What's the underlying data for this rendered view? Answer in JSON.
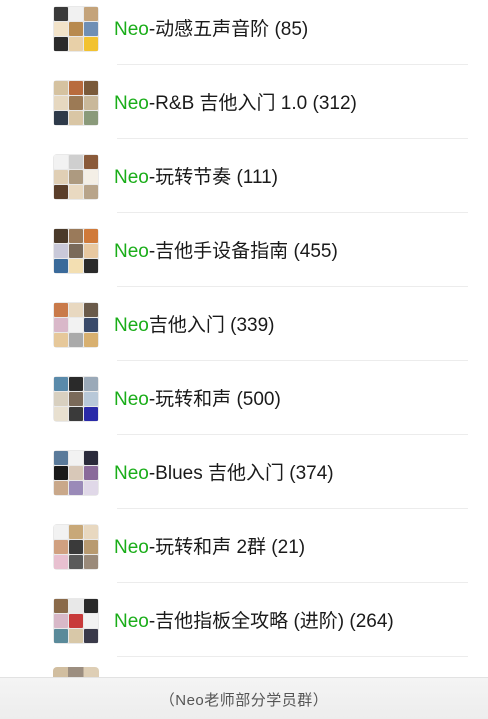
{
  "groups": [
    {
      "prefix": "Neo",
      "rest": "-动感五声音阶 (85)",
      "tiles": [
        "#3a3a3a",
        "#f1f1f1",
        "#c4a37a",
        "#f2e3c9",
        "#b88a4f",
        "#6f8fb5",
        "#2b2b2b",
        "#e8d0a8",
        "#f2c230"
      ]
    },
    {
      "prefix": "Neo",
      "rest": "-R&B 吉他入门 1.0 (312)",
      "tiles": [
        "#d5c2a0",
        "#b86b3d",
        "#7a5a3a",
        "#e6d8c0",
        "#9c7a55",
        "#c9b89a",
        "#2e3a4a",
        "#d9c6a5",
        "#8a9a7a"
      ]
    },
    {
      "prefix": "Neo",
      "rest": "-玩转节奏 (111)",
      "tiles": [
        "#f2f2f2",
        "#cfcfcf",
        "#8a5a3a",
        "#e0cfb5",
        "#ad9a80",
        "#f4efe6",
        "#5a3e2a",
        "#e9d9c1",
        "#b8a48a"
      ]
    },
    {
      "prefix": "Neo",
      "rest": "-吉他手设备指南 (455)",
      "tiles": [
        "#4a3a2a",
        "#9a7a5a",
        "#d07a3a",
        "#c9c9d9",
        "#7a6a5a",
        "#e8c8a0",
        "#3a6a9a",
        "#f3dfb2",
        "#2a2a2a"
      ]
    },
    {
      "prefix": "Neo",
      "rest": "吉他入门 (339)",
      "tiles": [
        "#c97a4a",
        "#e8d8c0",
        "#6a5a4a",
        "#d9b8c9",
        "#f2f2f2",
        "#3a4a6a",
        "#e6c89a",
        "#aaaaaa",
        "#d8b070"
      ]
    },
    {
      "prefix": "Neo",
      "rest": "-玩转和声 (500)",
      "tiles": [
        "#5a8aaa",
        "#2a2a2a",
        "#9aa9b8",
        "#d8d0c0",
        "#7a6a5a",
        "#b8c8d8",
        "#e8e0d0",
        "#3a3a3a",
        "#2a2aa8"
      ]
    },
    {
      "prefix": "Neo",
      "rest": "-Blues 吉他入门 (374)",
      "tiles": [
        "#5a7a9a",
        "#f2f2f2",
        "#2a2a3a",
        "#1a1a1a",
        "#d8c8b8",
        "#8a6a9a",
        "#c9a88a",
        "#9a8ab8",
        "#e0d8e8"
      ]
    },
    {
      "prefix": "Neo",
      "rest": "-玩转和声 2群 (21)",
      "tiles": [
        "#f2f2f2",
        "#c8a878",
        "#e8d8c0",
        "#d0a080",
        "#3a3a3a",
        "#b89a70",
        "#e8c0d0",
        "#5a5a5a",
        "#9a8a7a"
      ]
    },
    {
      "prefix": "Neo",
      "rest": "-吉他指板全攻略 (进阶) (264)",
      "tiles": [
        "#8a6a4a",
        "#e8e8e8",
        "#2a2a2a",
        "#d8b8c8",
        "#c83a3a",
        "#f2f2f2",
        "#5a8a9a",
        "#d8c8a8",
        "#3a3a4a"
      ]
    }
  ],
  "footer": {
    "caption": "（Neo老师部分学员群）"
  },
  "colors": {
    "prefix_green": "#1aad19",
    "text": "#1a1a1a"
  }
}
